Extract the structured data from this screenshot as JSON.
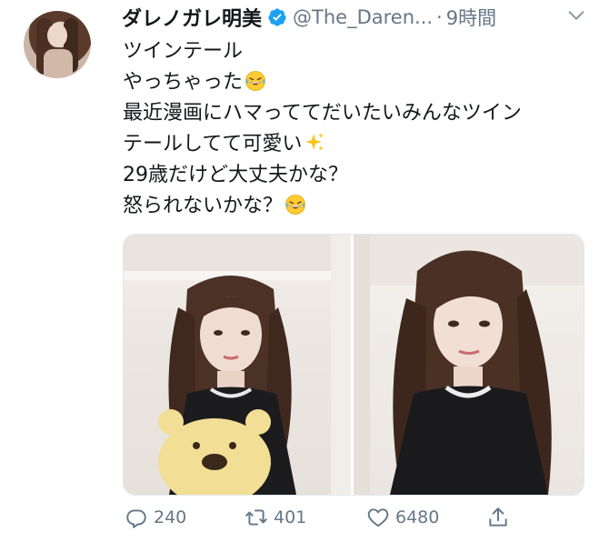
{
  "tweet": {
    "display_name": "ダレノガレ明美",
    "handle": "@The_Daren...",
    "separator": "·",
    "time": "9時間",
    "text_lines": [
      "ツインテール",
      "やっちゃった",
      "最近漫画にハマっててだいたいみんなツイン",
      "テールしてて可愛い",
      "29歳だけど大丈夫かな？",
      "怒られないかな？"
    ],
    "emojis": [
      "laughing-tears-emoji",
      "sparkles-emoji",
      "laughing-tears-emoji"
    ]
  },
  "actions": {
    "reply_count": "240",
    "retweet_count": "401",
    "like_count": "6480"
  },
  "colors": {
    "text": "#14171a",
    "secondary": "#657786",
    "verified": "#1da1f2"
  }
}
